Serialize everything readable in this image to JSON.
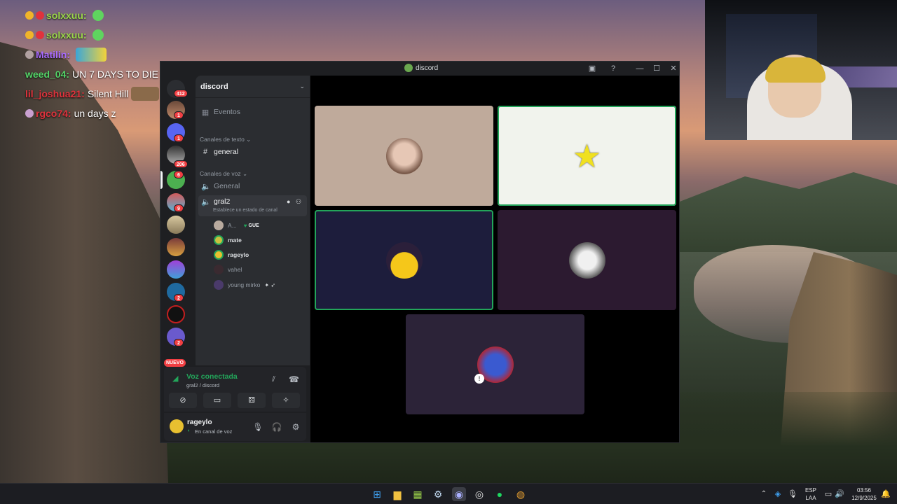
{
  "chat": [
    {
      "user": "solxxuu:",
      "message": "",
      "color": "#9bd84a"
    },
    {
      "user": "solxxuu:",
      "message": "",
      "color": "#9bd84a"
    },
    {
      "user": "Matilin:",
      "message": "",
      "color": "#a86bff"
    },
    {
      "user": "weed_04:",
      "message": "UN 7 DAYS TO DIE",
      "color": "#54d468"
    },
    {
      "user": "lil_joshua21:",
      "message": "Silent Hill",
      "color": "#e0323c"
    },
    {
      "user": "rgco74:",
      "message": "un days z",
      "color": "#e0323c"
    }
  ],
  "window": {
    "title": "discord",
    "minimize": "—",
    "maximize": "☐",
    "close": "✕"
  },
  "servers": {
    "badges": [
      "412",
      "1",
      "1",
      "206",
      "6",
      "9",
      "2",
      "2"
    ],
    "nuevo_label": "NUEVO"
  },
  "guild": {
    "name": "discord",
    "events_label": "Eventos",
    "text_category": "Canales de texto",
    "text_channel": "general",
    "voice_category": "Canales de voz",
    "voice_channel_general": "General",
    "voice_channel_active": "gral2",
    "voice_channel_status": "Establece un estado de canal",
    "voice_users": [
      {
        "name": "A...",
        "tag": "GUE"
      },
      {
        "name": "mate",
        "tag": ""
      },
      {
        "name": "rageylo",
        "tag": ""
      },
      {
        "name": "vahel",
        "tag": ""
      },
      {
        "name": "young mirko",
        "tag": ""
      }
    ]
  },
  "voice_panel": {
    "status": "Voz conectada",
    "location": "gral2 / discord"
  },
  "user_panel": {
    "username": "rageylo",
    "status": "En canal de voz"
  },
  "tray": {
    "lang_line1": "ESP",
    "lang_line2": "LAA",
    "time": "03:56",
    "date": "12/9/2025"
  },
  "colors": {
    "discord_bg": "#1e1f22",
    "sidebar_bg": "#2b2d31",
    "speaking_green": "#23a55a",
    "notification_red": "#f23f43"
  }
}
